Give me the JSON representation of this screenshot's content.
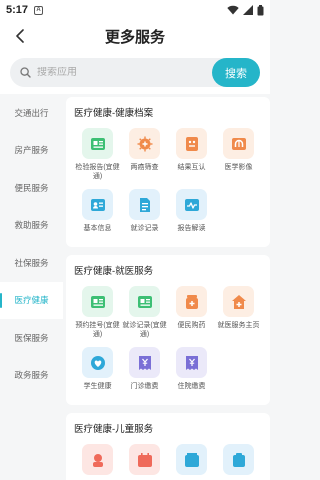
{
  "status": {
    "time": "5:17",
    "notif_glyph": "A"
  },
  "header": {
    "title": "更多服务"
  },
  "search": {
    "placeholder": "搜索应用",
    "button": "搜索"
  },
  "sidebar": {
    "items": [
      {
        "label": "交通出行",
        "active": false
      },
      {
        "label": "房产服务",
        "active": false
      },
      {
        "label": "便民服务",
        "active": false
      },
      {
        "label": "救助服务",
        "active": false
      },
      {
        "label": "社保服务",
        "active": false
      },
      {
        "label": "医疗健康",
        "active": true
      },
      {
        "label": "医保服务",
        "active": false
      },
      {
        "label": "政务服务",
        "active": false
      }
    ]
  },
  "sections": [
    {
      "title": "医疗健康-健康档案",
      "items": [
        {
          "label": "检验报告(宜健通)",
          "icon": "lab-report-icon",
          "color": "green"
        },
        {
          "label": "两癌筛查",
          "icon": "cancer-screening-icon",
          "color": "orange"
        },
        {
          "label": "结果互认",
          "icon": "result-mutual-icon",
          "color": "orange"
        },
        {
          "label": "医学影像",
          "icon": "medical-imaging-icon",
          "color": "orange"
        },
        {
          "label": "基本信息",
          "icon": "basic-info-icon",
          "color": "blue"
        },
        {
          "label": "就诊记录",
          "icon": "visit-record-icon",
          "color": "blue"
        },
        {
          "label": "报告解读",
          "icon": "report-interpret-icon",
          "color": "blue"
        }
      ]
    },
    {
      "title": "医疗健康-就医服务",
      "items": [
        {
          "label": "预约挂号(宜健通)",
          "icon": "appointment-icon",
          "color": "green"
        },
        {
          "label": "就诊记录(宜健通)",
          "icon": "visit-record-green-icon",
          "color": "green"
        },
        {
          "label": "便民购药",
          "icon": "medicine-icon",
          "color": "orange"
        },
        {
          "label": "就医服务主页",
          "icon": "hospital-home-icon",
          "color": "orange"
        },
        {
          "label": "学生健康",
          "icon": "student-health-icon",
          "color": "blue"
        },
        {
          "label": "门诊缴费",
          "icon": "outpatient-pay-icon",
          "color": "purple"
        },
        {
          "label": "住院缴费",
          "icon": "inpatient-pay-icon",
          "color": "purple"
        }
      ]
    },
    {
      "title": "医疗健康-儿童服务",
      "items": [
        {
          "label": "",
          "icon": "child-service-1-icon",
          "color": "red"
        },
        {
          "label": "",
          "icon": "child-service-2-icon",
          "color": "red"
        },
        {
          "label": "",
          "icon": "child-service-3-icon",
          "color": "blue"
        },
        {
          "label": "",
          "icon": "child-service-4-icon",
          "color": "blue"
        }
      ]
    }
  ],
  "colors": {
    "accent": "#25b5c9",
    "green": "#3dbf74",
    "orange": "#f08a4b",
    "blue": "#2ea8d8",
    "purple": "#7a6fd6",
    "red": "#ef6a5a"
  }
}
